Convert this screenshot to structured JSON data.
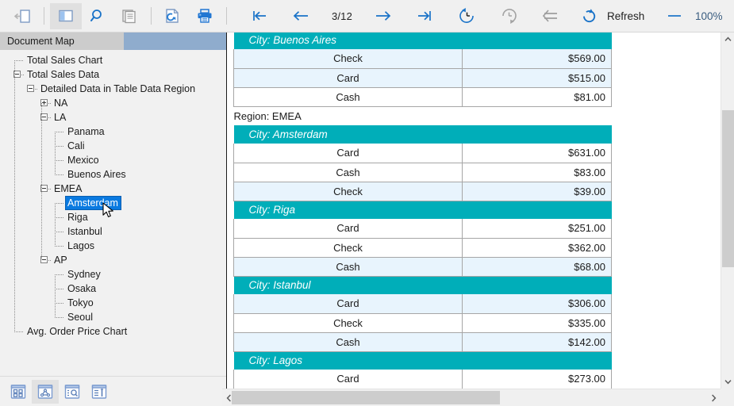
{
  "toolbar": {
    "back_icon": "back-to-parent-page-icon",
    "panel_toggle_icon": "toggle-side-panel-icon",
    "search_icon": "search-icon",
    "pages_icon": "page-layout-icon",
    "refresh_page_icon": "refresh-document-icon",
    "print_icon": "print-icon",
    "first_page_icon": "first-page-icon",
    "prev_page_icon": "previous-page-icon",
    "page_indicator": "3/12",
    "next_page_icon": "next-page-icon",
    "last_page_icon": "last-page-icon",
    "history_back_icon": "history-back-icon",
    "history_forward_icon": "history-forward-icon",
    "parent_report_icon": "go-to-parent-report-icon",
    "refresh_icon": "refresh-icon",
    "refresh_label": "Refresh",
    "zoom_out_label": "—",
    "zoom_value": "100%",
    "zoom_in_label": "+"
  },
  "sidebar": {
    "tab_label": "Document Map",
    "tree": [
      {
        "label": "Total Sales Chart",
        "indent": 0,
        "toggle": "none",
        "selected": false
      },
      {
        "label": "Total Sales Data",
        "indent": 0,
        "toggle": "minus",
        "selected": false
      },
      {
        "label": "Detailed Data in Table Data Region",
        "indent": 1,
        "toggle": "minus",
        "selected": false
      },
      {
        "label": "NA",
        "indent": 2,
        "toggle": "plus",
        "selected": false
      },
      {
        "label": "LA",
        "indent": 2,
        "toggle": "minus",
        "selected": false
      },
      {
        "label": "Panama",
        "indent": 3,
        "toggle": "none",
        "selected": false
      },
      {
        "label": "Cali",
        "indent": 3,
        "toggle": "none",
        "selected": false
      },
      {
        "label": "Mexico",
        "indent": 3,
        "toggle": "none",
        "selected": false
      },
      {
        "label": "Buenos Aires",
        "indent": 3,
        "toggle": "none",
        "selected": false
      },
      {
        "label": "EMEA",
        "indent": 2,
        "toggle": "minus",
        "selected": false
      },
      {
        "label": "Amsterdam",
        "indent": 3,
        "toggle": "none",
        "selected": true
      },
      {
        "label": "Riga",
        "indent": 3,
        "toggle": "none",
        "selected": false
      },
      {
        "label": "Istanbul",
        "indent": 3,
        "toggle": "none",
        "selected": false
      },
      {
        "label": "Lagos",
        "indent": 3,
        "toggle": "none",
        "selected": false
      },
      {
        "label": "AP",
        "indent": 2,
        "toggle": "minus",
        "selected": false
      },
      {
        "label": "Sydney",
        "indent": 3,
        "toggle": "none",
        "selected": false
      },
      {
        "label": "Osaka",
        "indent": 3,
        "toggle": "none",
        "selected": false
      },
      {
        "label": "Tokyo",
        "indent": 3,
        "toggle": "none",
        "selected": false
      },
      {
        "label": "Seoul",
        "indent": 3,
        "toggle": "none",
        "selected": false
      },
      {
        "label": "Avg. Order Price Chart",
        "indent": 0,
        "toggle": "none",
        "selected": false
      }
    ],
    "panel_buttons": [
      {
        "icon": "thumbnails-panel-icon",
        "selected": false
      },
      {
        "icon": "document-map-panel-icon",
        "selected": true
      },
      {
        "icon": "search-panel-icon",
        "selected": false
      },
      {
        "icon": "parameters-panel-icon",
        "selected": false
      }
    ]
  },
  "report": {
    "rows": [
      {
        "type": "city",
        "label": "City: Buenos Aires"
      },
      {
        "type": "data",
        "payment": "Check",
        "amount": "$569.00",
        "shade": "alt"
      },
      {
        "type": "data",
        "payment": "Card",
        "amount": "$515.00",
        "shade": "alt"
      },
      {
        "type": "data",
        "payment": "Cash",
        "amount": "$81.00",
        "shade": "plain"
      },
      {
        "type": "region",
        "label": "Region: EMEA"
      },
      {
        "type": "city",
        "label": "City: Amsterdam"
      },
      {
        "type": "data",
        "payment": "Card",
        "amount": "$631.00",
        "shade": "plain"
      },
      {
        "type": "data",
        "payment": "Cash",
        "amount": "$83.00",
        "shade": "plain"
      },
      {
        "type": "data",
        "payment": "Check",
        "amount": "$39.00",
        "shade": "alt"
      },
      {
        "type": "city",
        "label": "City: Riga"
      },
      {
        "type": "data",
        "payment": "Card",
        "amount": "$251.00",
        "shade": "plain"
      },
      {
        "type": "data",
        "payment": "Check",
        "amount": "$362.00",
        "shade": "plain"
      },
      {
        "type": "data",
        "payment": "Cash",
        "amount": "$68.00",
        "shade": "alt"
      },
      {
        "type": "city",
        "label": "City: Istanbul"
      },
      {
        "type": "data",
        "payment": "Card",
        "amount": "$306.00",
        "shade": "alt"
      },
      {
        "type": "data",
        "payment": "Check",
        "amount": "$335.00",
        "shade": "plain"
      },
      {
        "type": "data",
        "payment": "Cash",
        "amount": "$142.00",
        "shade": "alt"
      },
      {
        "type": "city",
        "label": "City: Lagos"
      },
      {
        "type": "data",
        "payment": "Card",
        "amount": "$273.00",
        "shade": "plain"
      }
    ]
  },
  "colors": {
    "city_header": "#00aeb9",
    "region_header": "#0071b9",
    "row_alt": "#e8f4fd",
    "selection": "#0a7ae0",
    "toolbar_bg": "#f0f0f0",
    "tab_active": "#cccccc",
    "tab_filler": "#8faccd"
  }
}
